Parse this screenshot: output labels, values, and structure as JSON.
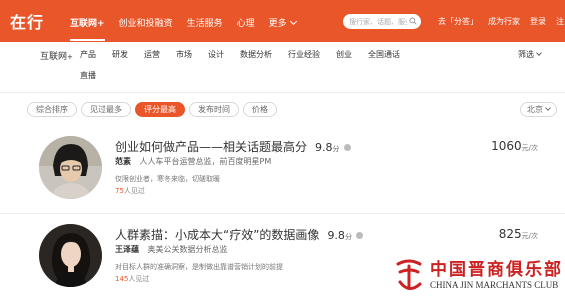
{
  "header": {
    "logo": "在行",
    "nav": [
      {
        "label": "互联网+",
        "active": true
      },
      {
        "label": "创业和投融资",
        "active": false
      },
      {
        "label": "生活服务",
        "active": false
      },
      {
        "label": "心理",
        "active": false
      },
      {
        "label": "更多",
        "active": false
      }
    ],
    "search_placeholder": "搜行家、话题、服务",
    "right_links": [
      "去「分答」",
      "成为行家",
      "登录",
      "注"
    ]
  },
  "subnav": {
    "category": "互联网",
    "category_suffix": "+",
    "links": [
      "产品",
      "研发",
      "运营",
      "市场",
      "设计",
      "数据分析",
      "行业经验",
      "创业",
      "全国通话"
    ],
    "second_line": "直播",
    "filter_label": "筛选"
  },
  "sort": {
    "options": [
      {
        "label": "综合排序",
        "active": false
      },
      {
        "label": "见过最多",
        "active": false
      },
      {
        "label": "评分最高",
        "active": true
      },
      {
        "label": "发布时间",
        "active": false
      },
      {
        "label": "价格",
        "active": false
      }
    ],
    "city": "北京"
  },
  "experts": [
    {
      "title": "创业如何做产品——相关话题最高分",
      "score": "9.8",
      "score_unit": "分",
      "name": "范素",
      "role": "人人车平台运营总监，前百度明星PM",
      "desc": "仅限创业者，寒冬来临，切磋取暖",
      "seen_count": "75",
      "seen_text": "人见过",
      "price": "1060",
      "price_unit": "元/次"
    },
    {
      "title": "人群素描：小成本大“疗效”的数据画像",
      "score": "9.8",
      "score_unit": "分",
      "name": "王泽蕴",
      "role": "奥美公关数据分析总监",
      "desc": "对目标人群的准确洞察，是制做出靠谱营销计划的前提",
      "seen_count": "145",
      "seen_text": "人见过",
      "price": "825",
      "price_unit": "元/次"
    }
  ],
  "watermark": {
    "cn": "中国晋商俱乐部",
    "en": "CHINA JIN MARCHANTS CLUB"
  },
  "colors": {
    "accent": "#e8562a",
    "watermark_red": "#cc2222"
  }
}
